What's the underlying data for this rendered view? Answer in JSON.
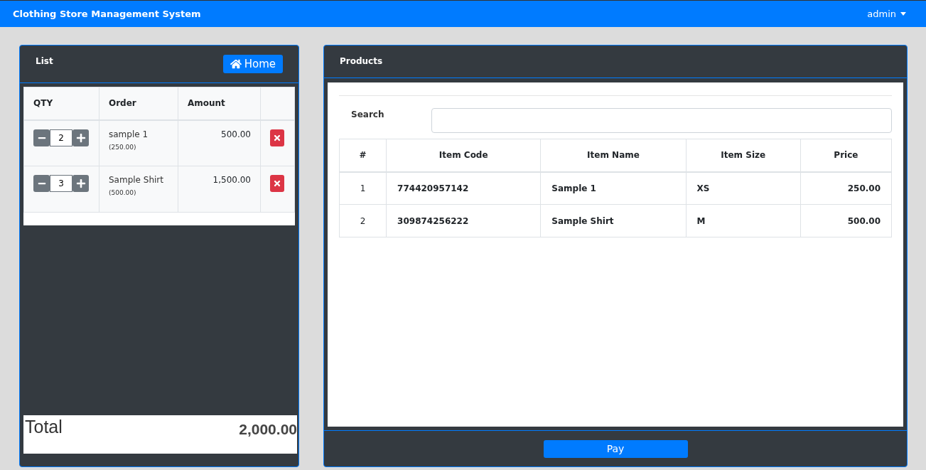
{
  "navbar": {
    "title": "Clothing Store Management System",
    "user_menu": "admin"
  },
  "cart": {
    "title": "List",
    "home_button": "Home",
    "columns": [
      "QTY",
      "Order",
      "Amount"
    ],
    "rows": [
      {
        "qty": "2",
        "name": "sample 1",
        "unit_price": "(250.00)",
        "amount": "500.00"
      },
      {
        "qty": "3",
        "name": "Sample Shirt",
        "unit_price": "(500.00)",
        "amount": "1,500.00"
      }
    ],
    "total_label": "Total",
    "total_value": "2,000.00"
  },
  "products": {
    "title": "Products",
    "search_label": "Search",
    "columns": [
      "#",
      "Item Code",
      "Item Name",
      "Item Size",
      "Price"
    ],
    "rows": [
      [
        "1",
        "774420957142",
        "Sample 1",
        "XS",
        "250.00"
      ],
      [
        "2",
        "309874256222",
        "Sample Shirt",
        "M",
        "500.00"
      ]
    ],
    "pay_button": "Pay"
  }
}
